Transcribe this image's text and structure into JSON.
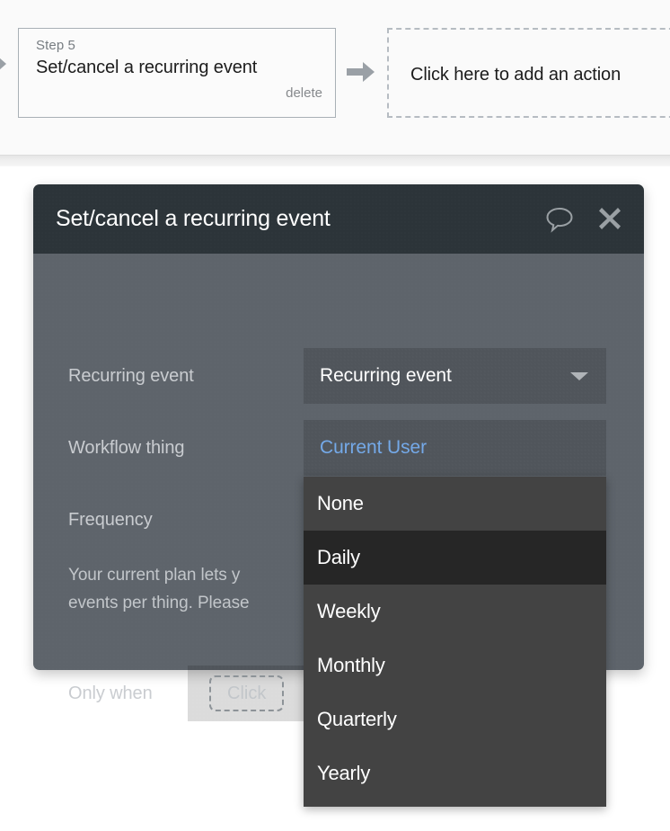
{
  "workflow": {
    "step_label": "Step 5",
    "step_title": "Set/cancel a recurring event",
    "delete_label": "delete",
    "add_action_label": "Click here to add an action"
  },
  "modal": {
    "title": "Set/cancel a recurring event",
    "comment_icon": "speech-bubble-icon",
    "close_icon": "close-x-icon",
    "fields": {
      "recurring_event": {
        "label": "Recurring event",
        "value": "Recurring event"
      },
      "workflow_thing": {
        "label": "Workflow thing",
        "value": "Current User"
      },
      "frequency": {
        "label": "Frequency",
        "value": ""
      },
      "only_when": {
        "label": "Only when",
        "placeholder": "Click"
      }
    },
    "plan_notice_line1": "Your current plan lets y",
    "plan_notice_line2": "events per thing. Please"
  },
  "frequency_dropdown": {
    "options": [
      {
        "label": "None",
        "selected": false
      },
      {
        "label": "Daily",
        "selected": true
      },
      {
        "label": "Weekly",
        "selected": false
      },
      {
        "label": "Monthly",
        "selected": false
      },
      {
        "label": "Quarterly",
        "selected": false
      },
      {
        "label": "Yearly",
        "selected": false
      }
    ]
  },
  "colors": {
    "modal_header": "#2c3439",
    "modal_body": "#5e646b",
    "error_border": "#ef3a62",
    "link_blue": "#74a9e8",
    "dropdown_bg": "#434343",
    "dropdown_selected": "#262626"
  }
}
